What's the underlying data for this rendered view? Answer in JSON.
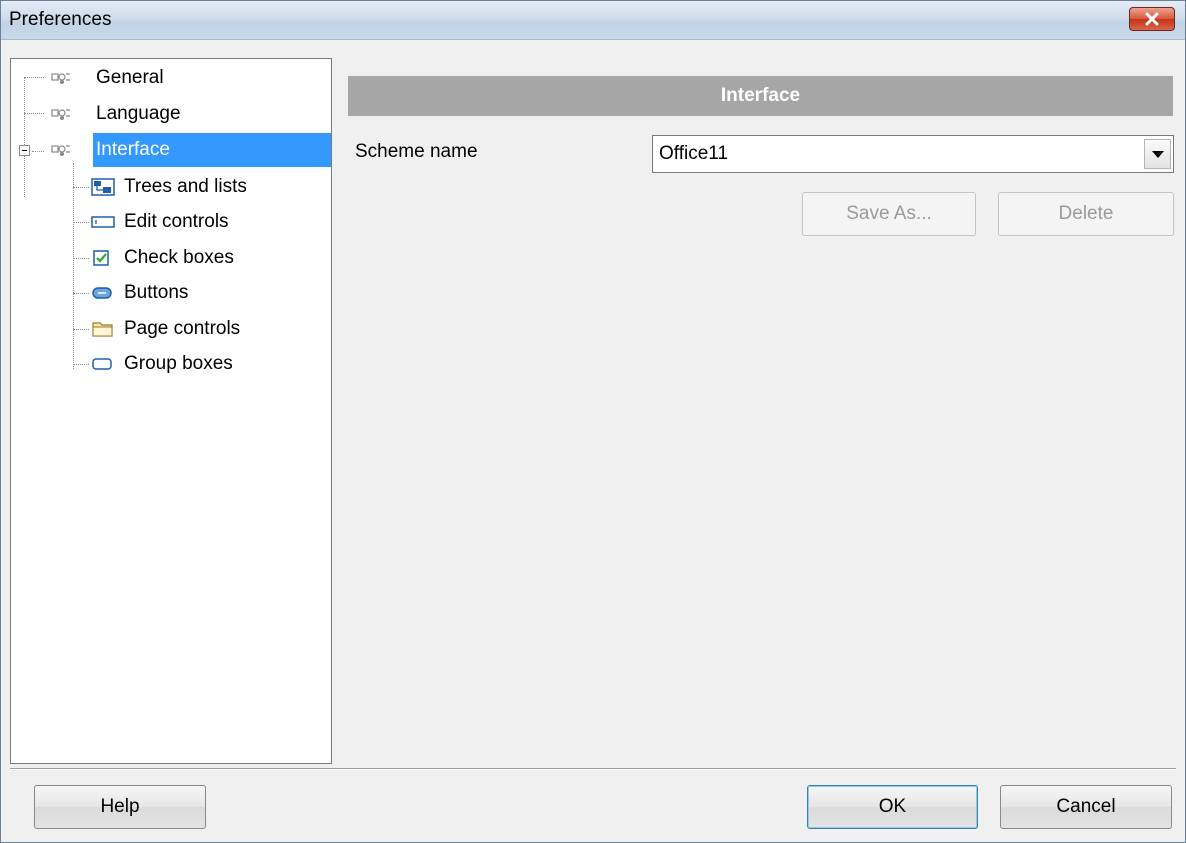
{
  "window": {
    "title": "Preferences"
  },
  "tree": {
    "items": [
      {
        "label": "General",
        "icon": "gear-icon"
      },
      {
        "label": "Language",
        "icon": "gear-icon"
      },
      {
        "label": "Interface",
        "icon": "gear-icon",
        "selected": true,
        "expanded": true
      },
      {
        "label": "Trees and lists",
        "icon": "tree-list-icon"
      },
      {
        "label": "Edit controls",
        "icon": "edit-control-icon"
      },
      {
        "label": "Check boxes",
        "icon": "checkbox-icon"
      },
      {
        "label": "Buttons",
        "icon": "button-icon"
      },
      {
        "label": "Page controls",
        "icon": "folder-tab-icon"
      },
      {
        "label": "Group boxes",
        "icon": "group-box-icon"
      }
    ]
  },
  "panel": {
    "header": "Interface",
    "scheme_label": "Scheme name",
    "scheme_value": "Office11",
    "save_as_label": "Save As...",
    "delete_label": "Delete"
  },
  "footer": {
    "help_label": "Help",
    "ok_label": "OK",
    "cancel_label": "Cancel"
  },
  "colors": {
    "selection": "#3399ff",
    "header_bar": "#a6a6a6",
    "close_button": "#c3361a"
  }
}
